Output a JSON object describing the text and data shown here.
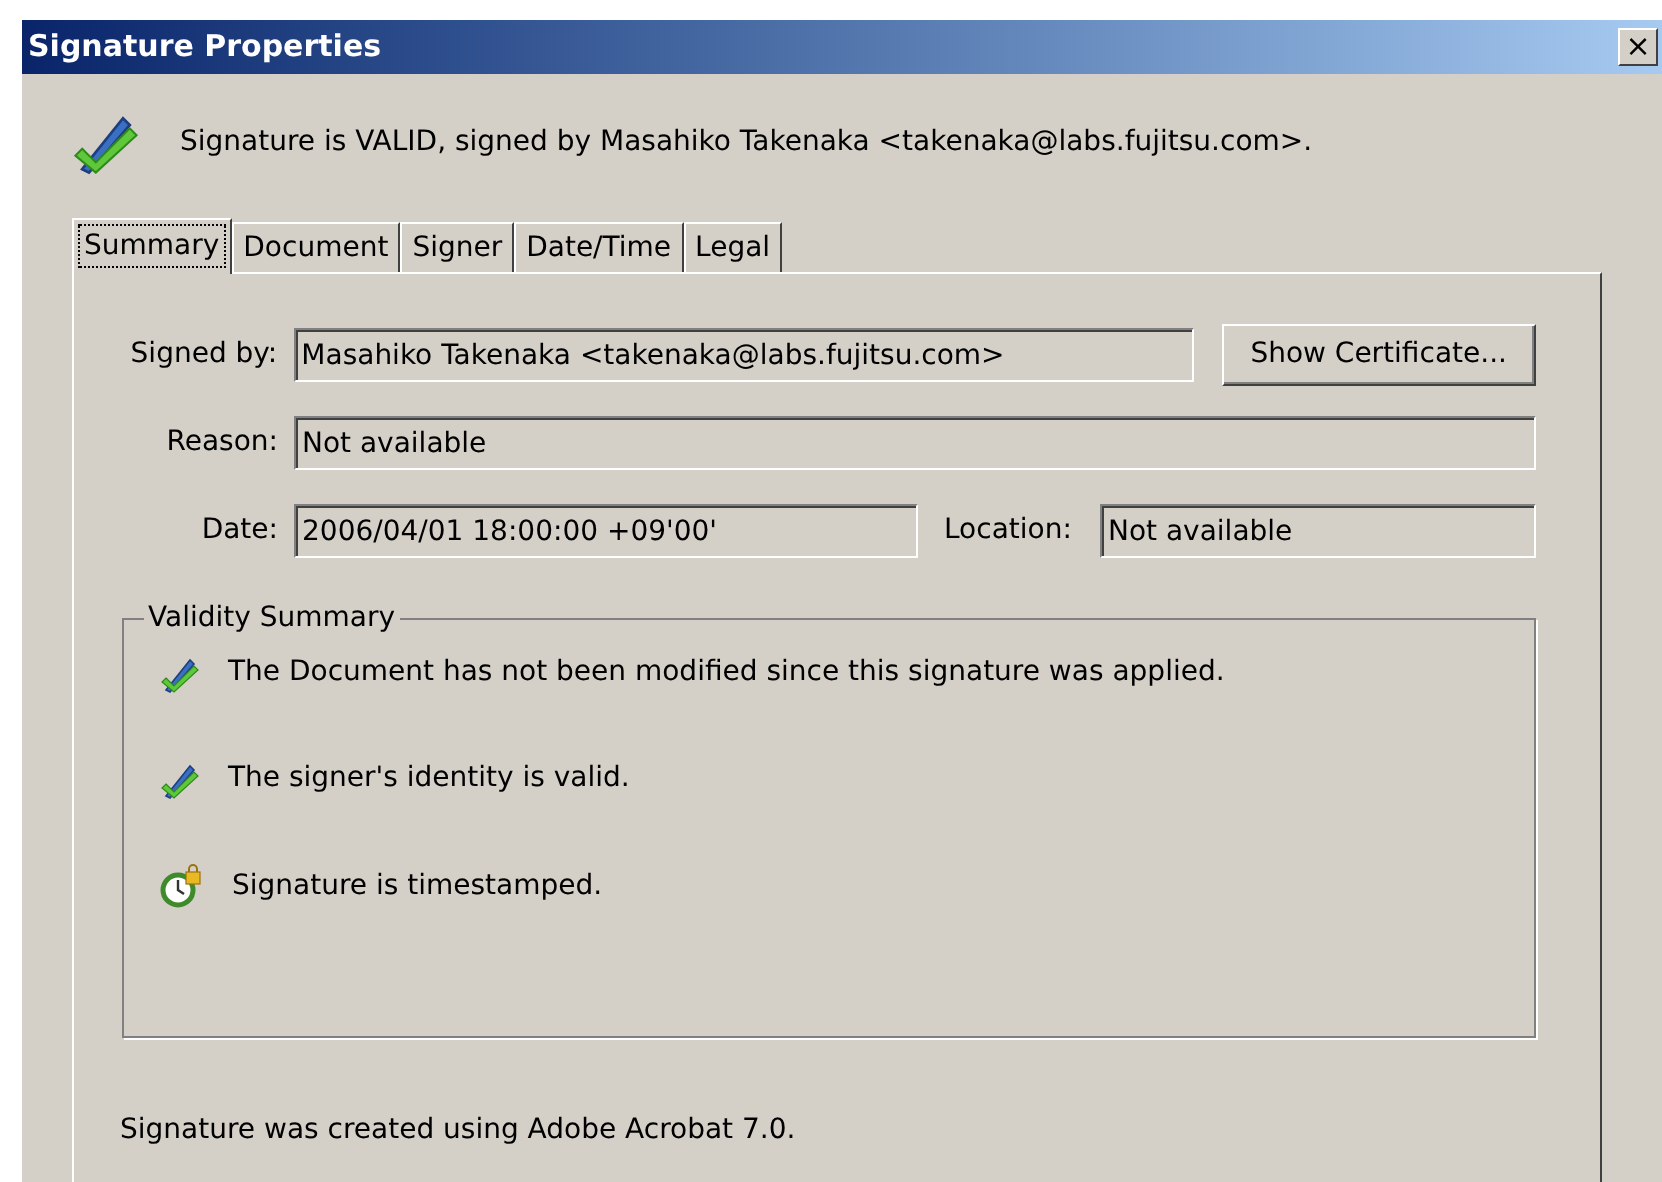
{
  "window": {
    "title": "Signature Properties",
    "close": "×"
  },
  "status_message": "Signature is VALID, signed by Masahiko Takenaka <takenaka@labs.fujitsu.com>.",
  "tabs": [
    {
      "label": "Summary",
      "selected": true
    },
    {
      "label": "Document",
      "selected": false
    },
    {
      "label": "Signer",
      "selected": false
    },
    {
      "label": "Date/Time",
      "selected": false
    },
    {
      "label": "Legal",
      "selected": false
    }
  ],
  "fields": {
    "signed_by": {
      "label": "Signed by:",
      "value": "Masahiko Takenaka <takenaka@labs.fujitsu.com>"
    },
    "show_certificate_button": "Show Certificate...",
    "reason": {
      "label": "Reason:",
      "value": "Not available"
    },
    "date": {
      "label": "Date:",
      "value": "2006/04/01 18:00:00 +09'00'"
    },
    "location": {
      "label": "Location:",
      "value": "Not available"
    }
  },
  "validity_summary": {
    "title": "Validity Summary",
    "items": [
      {
        "kind": "valid",
        "text": "The Document has not been modified since this signature was applied."
      },
      {
        "kind": "valid",
        "text": "The signer's identity is valid."
      },
      {
        "kind": "timestamp",
        "text": "Signature is timestamped."
      }
    ]
  },
  "footer": "Signature was created using Adobe Acrobat 7.0."
}
